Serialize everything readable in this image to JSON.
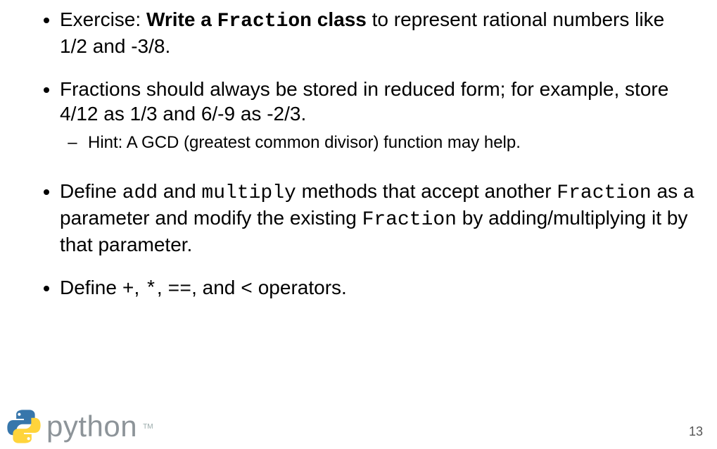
{
  "bullets": {
    "b1": {
      "prefix": "Exercise: ",
      "bold_pre": "Write a ",
      "code_bold": "Fraction",
      "bold_post": " class",
      "rest": " to represent rational numbers like 1/2 and -3/8."
    },
    "b2": {
      "text": "Fractions should always be stored in reduced form; for example, store 4/12 as 1/3 and 6/-9 as -2/3.",
      "sub": "Hint: A GCD (greatest common divisor) function may help."
    },
    "b3": {
      "p1": "Define ",
      "c1": "add",
      "p2": " and ",
      "c2": "multiply",
      "p3": " methods that accept another ",
      "c3": "Fraction",
      "p4": " as a parameter and modify the existing ",
      "c4": "Fraction",
      "p5": " by adding/multiplying it by that parameter."
    },
    "b4": {
      "p1": "Define ",
      "c1": "+",
      "p2": ", ",
      "c2": "*",
      "p3": ", ",
      "c3": "==",
      "p4": ", and ",
      "c4": "<",
      "p5": " operators."
    }
  },
  "footer": {
    "logo_text": "python",
    "tm": "TM",
    "page_number": "13"
  }
}
